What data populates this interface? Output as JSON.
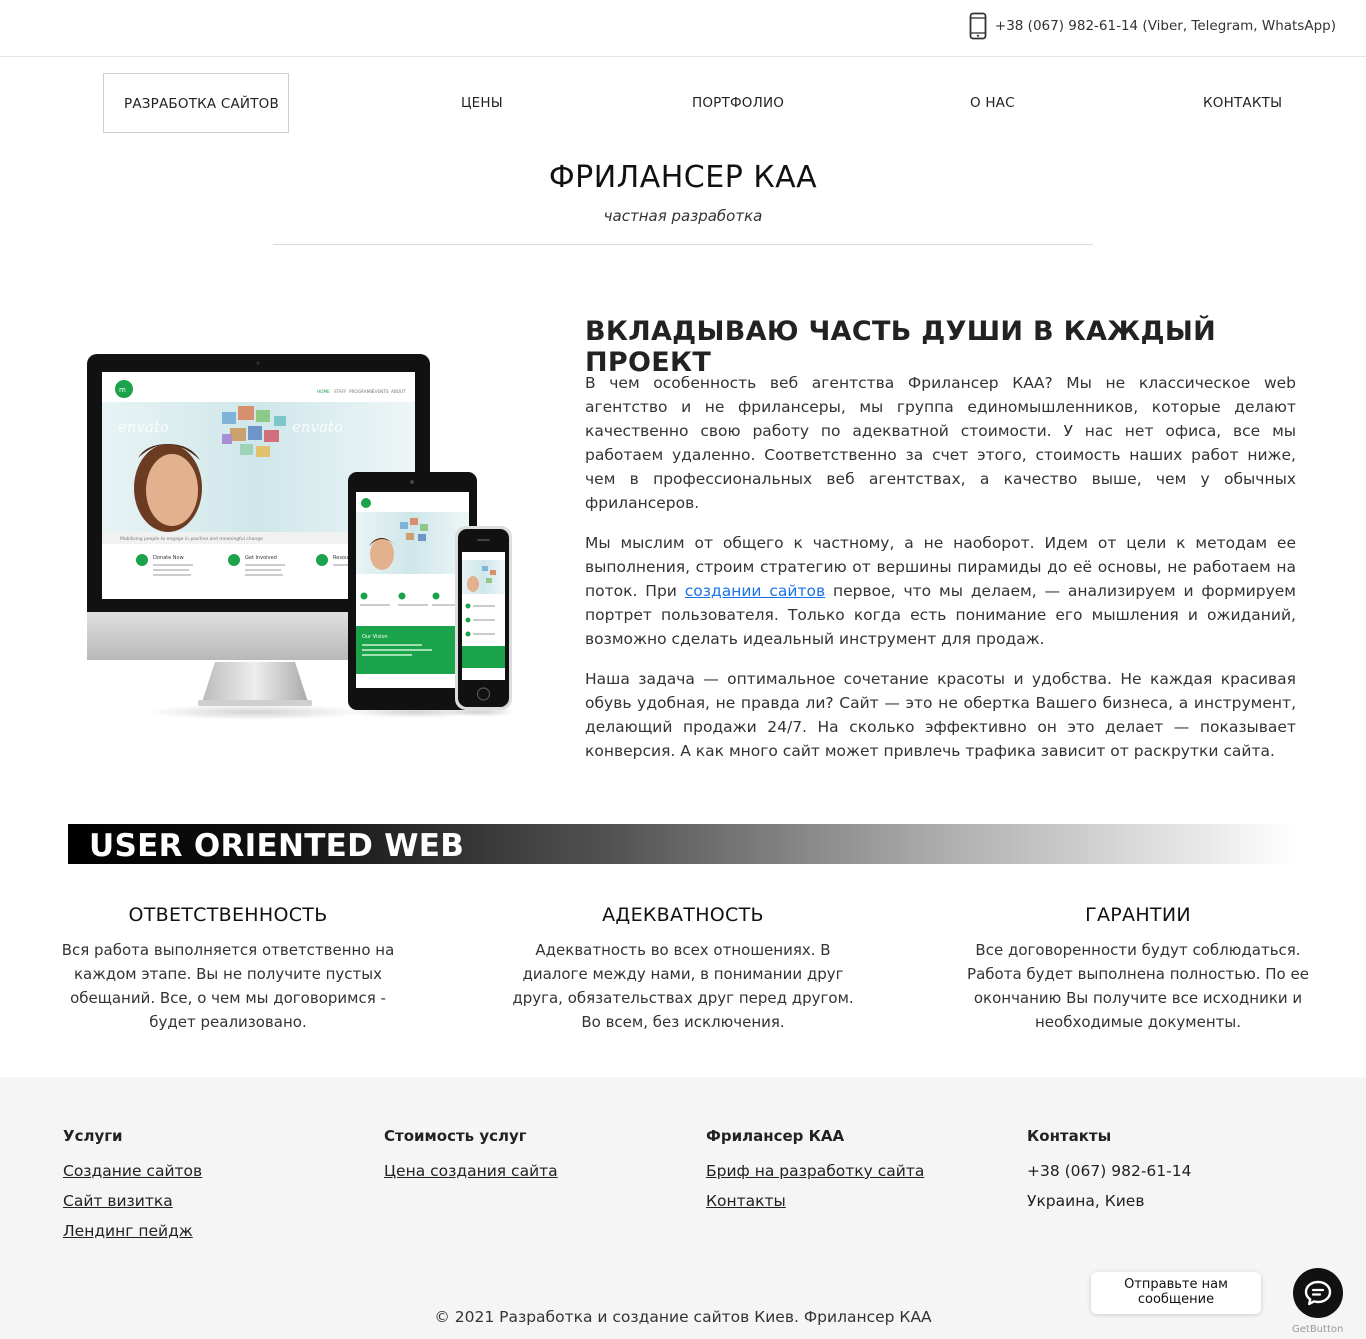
{
  "topbar": {
    "phone": "+38 (067) 982-61-14 (Viber, Telegram, WhatsApp)"
  },
  "nav": {
    "items": [
      {
        "label": "РАЗРАБОТКА САЙТОВ"
      },
      {
        "label": "ЦЕНЫ"
      },
      {
        "label": "ПОРТФОЛИО"
      },
      {
        "label": "О НАС"
      },
      {
        "label": "КОНТАКТЫ"
      }
    ]
  },
  "brand": {
    "title": "ФРИЛАНСЕР КАА",
    "subtitle": "частная разработка"
  },
  "hero": {
    "heading": "ВКЛАДЫВАЮ ЧАСТЬ ДУШИ В КАЖДЫЙ ПРОЕКТ",
    "p1": "В чем особенность веб агентства Фрилансер КАА? Мы не классическое web агентство и не фрилансеры, мы группа единомышленников, которые делают качественно свою работу по адекватной стоимости. У нас нет офиса, все мы работаем удаленно. Соответственно за счет этого, стоимость наших работ ниже, чем в профессиональных веб агентствах, а качество выше, чем у обычных фрилансеров.",
    "p2_before": "Мы мыслим от общего к частному, а не наоборот. Идем от цели к методам ее выполнения, строим стратегию от вершины пирамиды до её основы, не работаем на поток. При ",
    "p2_link": "создании сайтов",
    "p2_after": " первое, что мы делаем, — анализируем и формируем портрет пользователя. Только когда есть понимание его мышления и ожиданий, возможно сделать идеальный инструмент для продаж.",
    "p3": "Наша задача — оптимальное сочетание красоты и удобства. Не каждая красивая обувь удобная, не правда ли? Сайт — это не обертка Вашего бизнеса, а инструмент, делающий продажи 24/7. На сколько эффективно он это делает — показывает конверсия. А как много сайт может привлечь трафика зависит от раскрутки сайта."
  },
  "banner": {
    "text": "USER ORIENTED WEB"
  },
  "features": [
    {
      "title": "ОТВЕТСТВЕННОСТЬ",
      "text": "Вся работа выполняется ответственно на каждом этапе. Вы не получите пустых обещаний. Все, о чем мы договоримся - будет реализовано."
    },
    {
      "title": "АДЕКВАТНОСТЬ",
      "text": "Адекватность во всех отношениях. В диалоге между нами, в понимании друг друга, обязательствах друг перед другом. Во всем, без исключения."
    },
    {
      "title": "ГАРАНТИИ",
      "text": "Все договоренности будут соблюдаться. Работа будет выполнена полностью. По ее окончанию Вы получите все исходники и необходимые документы."
    }
  ],
  "footer": {
    "col1": {
      "title": "Услуги",
      "links": [
        "Создание сайтов",
        "Сайт визитка",
        "Лендинг пейдж"
      ]
    },
    "col2": {
      "title": "Стоимость услуг",
      "links": [
        "Цена создания сайта"
      ]
    },
    "col3": {
      "title": "Фрилансер КАА",
      "links": [
        "Бриф на разработку сайта",
        "Контакты"
      ]
    },
    "col4": {
      "title": "Контакты",
      "phone": "+38 (067) 982-61-14",
      "location": "Украина, Киев"
    },
    "copyright": "© 2021 Разработка и создание сайтов Киев. Фрилансер КАА"
  },
  "chat": {
    "line1": "Отправьте нам",
    "line2": "сообщение",
    "brand": "GetButton"
  },
  "mockup": {
    "nav": [
      "HOME",
      "STAFF",
      "PROGRAMS",
      "EVENTS",
      "ABOUT"
    ],
    "watermark": "envato",
    "tagline": "Mobilizing people to engage in positive and meaningful change",
    "cards": [
      "Donate Now",
      "Get Involved",
      "Resou"
    ],
    "vision": "Our Vision"
  },
  "colors": {
    "accent": "#1a73e8",
    "footer_bg": "#f5f5f5",
    "mock_green": "#1aa34a"
  }
}
